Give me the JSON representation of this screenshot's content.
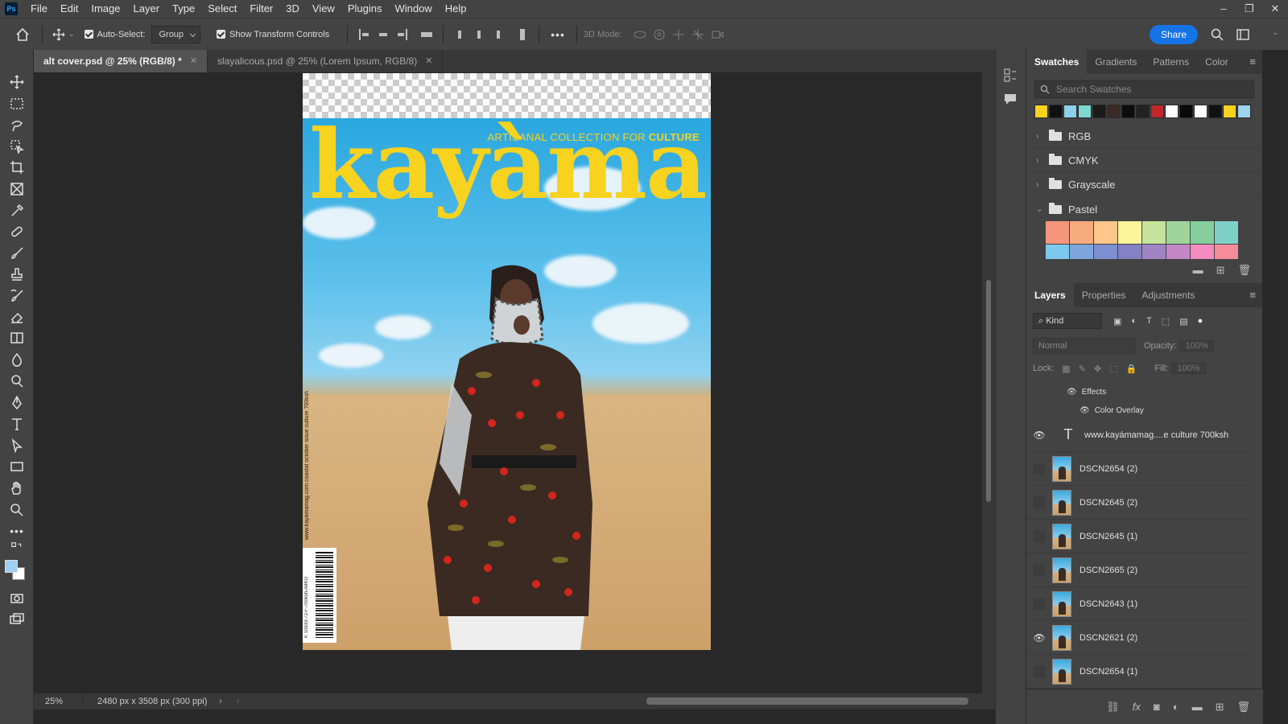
{
  "app": {
    "logo": "Ps"
  },
  "menu": [
    "File",
    "Edit",
    "Image",
    "Layer",
    "Type",
    "Select",
    "Filter",
    "3D",
    "View",
    "Plugins",
    "Window",
    "Help"
  ],
  "window_controls": {
    "minimize": "–",
    "restore": "❐",
    "close": "✕"
  },
  "options": {
    "auto_select_label": "Auto-Select:",
    "auto_select_value": "Group",
    "show_transform_label": "Show Transform Controls",
    "mode_3d_label": "3D Mode:",
    "more": "•••",
    "share": "Share"
  },
  "tabs": [
    {
      "label": "alt cover.psd @ 25% (RGB/8) *",
      "close": "✕"
    },
    {
      "label": "slayalicous.psd @ 25% (Lorem Ipsum, RGB/8)",
      "close": "✕"
    }
  ],
  "document": {
    "masthead": "kayàma",
    "tagline_prefix": "ARTISANAL COLLECTION FOR ",
    "tagline_bold": "CULTURE",
    "spine_text": "www.kayàmamag.com coastal october issue culture 700ksh",
    "barcode_number": "K 10933-72-F-700ksh-A8KO"
  },
  "status": {
    "zoom": "25%",
    "dimensions": "2480 px x 3508 px (300 ppi)"
  },
  "swatches": {
    "tabs": [
      "Swatches",
      "Gradients",
      "Patterns",
      "Color"
    ],
    "search_placeholder": "Search Swatches",
    "recent": [
      "#f7d21e",
      "#111111",
      "#8ecfe9",
      "#7dd8d0",
      "#1a1a1a",
      "#3a2a25",
      "#0d0d0d",
      "#222222",
      "#c0282c",
      "#ffffff",
      "#0a0a0a",
      "#ffffff",
      "#111111",
      "#f7d21e",
      "#9cd3ee"
    ],
    "groups": [
      {
        "name": "RGB",
        "open": false
      },
      {
        "name": "CMYK",
        "open": false
      },
      {
        "name": "Grayscale",
        "open": false
      },
      {
        "name": "Pastel",
        "open": true
      }
    ],
    "pastel_row1": [
      "#f6967d",
      "#f9ab80",
      "#fdc78a",
      "#fdf59a",
      "#c5e39a",
      "#9fd59a",
      "#85cf9d",
      "#7fd1c7"
    ],
    "pastel_row2": [
      "#7dc9ee",
      "#7ea6dc",
      "#7d8fd1",
      "#8481c4",
      "#a184c4",
      "#c487c4",
      "#f48cc0",
      "#f58c9a"
    ]
  },
  "layers": {
    "tabs": [
      "Layers",
      "Properties",
      "Adjustments"
    ],
    "kind_label": "Kind",
    "blend_mode": "Normal",
    "opacity_label": "Opacity:",
    "opacity_value": "100%",
    "lock_label": "Lock:",
    "fill_label": "Fill:",
    "fill_value": "100%",
    "effects_label": "Effects",
    "effect_name": "Color Overlay",
    "type_layer": "www.kayámamag....e culture 700ksh",
    "items": [
      {
        "name": "DSCN2654 (2)",
        "visible": false
      },
      {
        "name": "DSCN2645 (2)",
        "visible": false
      },
      {
        "name": "DSCN2645 (1)",
        "visible": false
      },
      {
        "name": "DSCN2665 (2)",
        "visible": false
      },
      {
        "name": "DSCN2643 (1)",
        "visible": false
      },
      {
        "name": "DSCN2621 (2)",
        "visible": true
      },
      {
        "name": "DSCN2654 (1)",
        "visible": false
      }
    ]
  }
}
